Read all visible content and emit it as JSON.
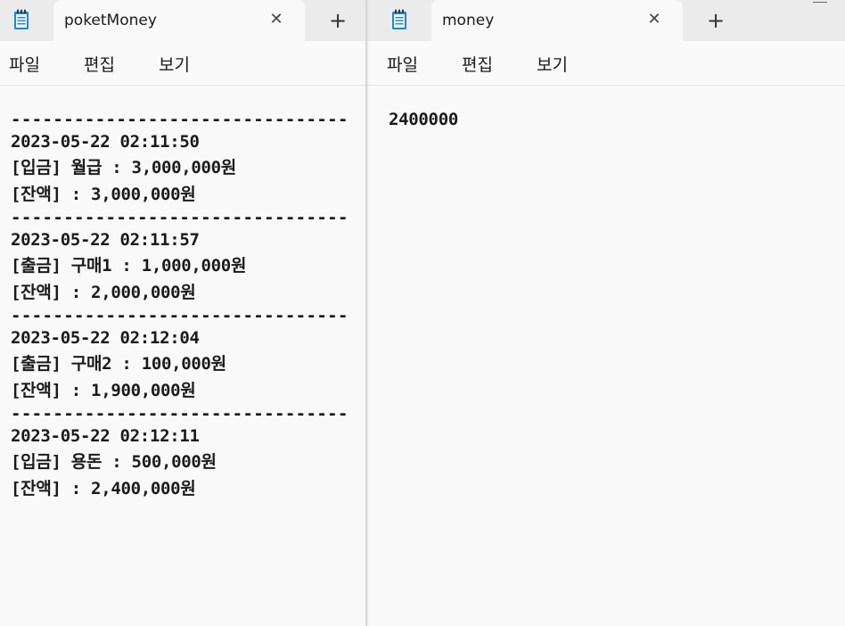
{
  "left_window": {
    "tab_title": "poketMoney",
    "close_symbol": "✕",
    "new_tab_symbol": "+",
    "menu": [
      "파일",
      "편집",
      "보기"
    ],
    "lines": [
      "--------------------------------",
      "2023-05-22 02:11:50",
      "[입금] 월급 : 3,000,000원",
      "[잔액] : 3,000,000원",
      "--------------------------------",
      "2023-05-22 02:11:57",
      "[출금] 구매1 : 1,000,000원",
      "[잔액] : 2,000,000원",
      "--------------------------------",
      "2023-05-22 02:12:04",
      "[출금] 구매2 : 100,000원",
      "[잔액] : 1,900,000원",
      "--------------------------------",
      "2023-05-22 02:12:11",
      "[입금] 용돈 : 500,000원",
      "[잔액] : 2,400,000원"
    ]
  },
  "right_window": {
    "tab_title": "money",
    "close_symbol": "✕",
    "new_tab_symbol": "+",
    "menu": [
      "파일",
      "편집",
      "보기"
    ],
    "lines": [
      "2400000"
    ]
  },
  "icons": {
    "app": "notepad-icon",
    "close": "close-icon",
    "new_tab": "plus-icon",
    "minimize": "minimize-icon"
  },
  "colors": {
    "tabbar_bg": "#ebebeb",
    "editor_bg": "#f9f9f9",
    "icon_blue": "#1e88c8"
  }
}
